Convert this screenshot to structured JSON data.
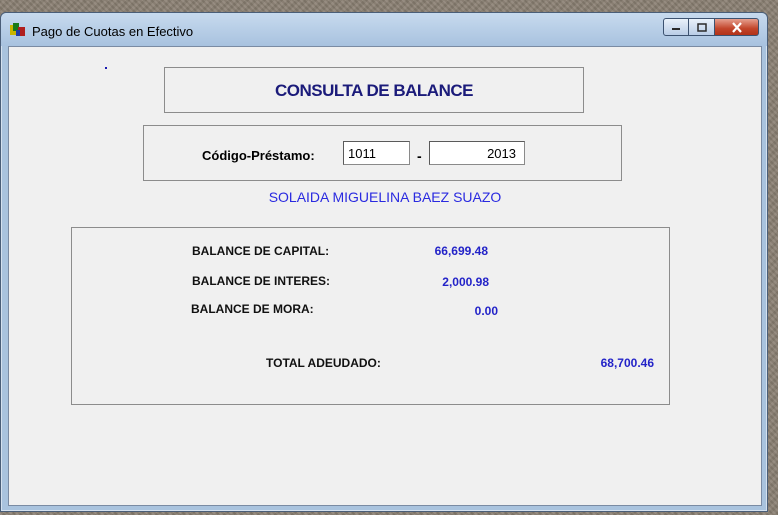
{
  "window": {
    "title": "Pago de Cuotas en Efectivo"
  },
  "header": {
    "title": "CONSULTA DE BALANCE"
  },
  "loan": {
    "label": "Código-Préstamo:",
    "code_value": "1011",
    "separator": "-",
    "year_value": "2013"
  },
  "client": {
    "name": "SOLAIDA MIGUELINA BAEZ SUAZO"
  },
  "balances": {
    "capital_label": "BALANCE DE CAPITAL:",
    "capital_value": "66,699.48",
    "interest_label": "BALANCE DE INTERES:",
    "interest_value": "2,000.98",
    "late_label": "BALANCE DE MORA:",
    "late_value": "0.00",
    "total_label": "TOTAL ADEUDADO:",
    "total_value": "68,700.46"
  },
  "colors": {
    "value_blue": "#2323c8",
    "name_blue": "#2a2ae0",
    "title_navy": "#1b1b7a"
  }
}
